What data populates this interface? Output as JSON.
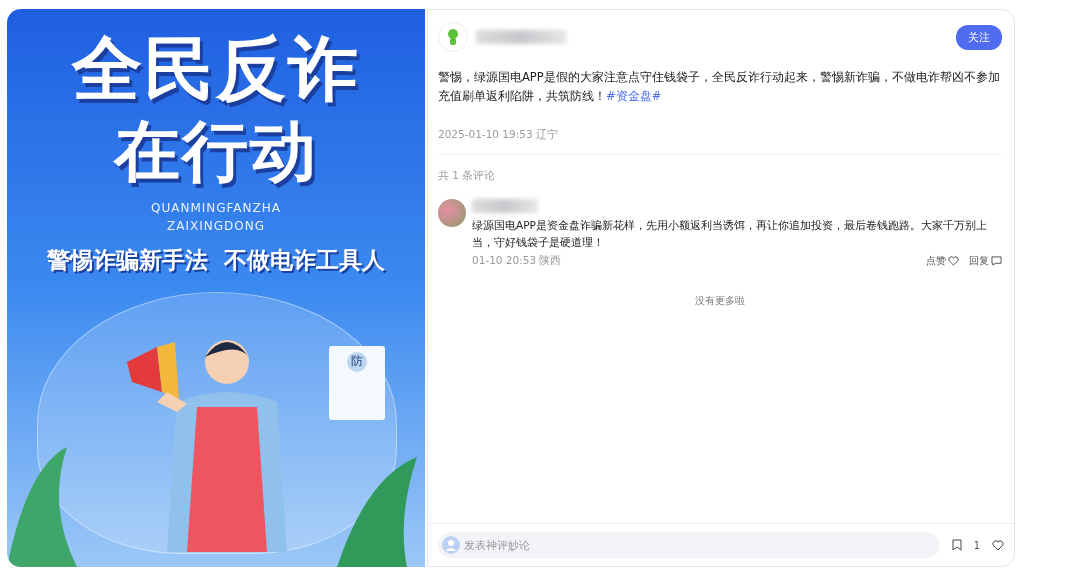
{
  "poster": {
    "title_lines": [
      "全民反诈",
      "在行动"
    ],
    "pinyin_lines": [
      "QUANMINGFANZHA",
      "ZAIXINGDONG"
    ],
    "slogan": "警惕诈骗新手法  不做电诈工具人",
    "document_label": "防"
  },
  "post": {
    "follow_button": "关注",
    "text": "警惕，绿源国电APP是假的大家注意点守住钱袋子，全民反诈行动起来，警惕新诈骗，不做电诈帮凶不参加充值刷单返利陷阱，共筑防线！",
    "hashtag": "#资金盘#",
    "meta": "2025-01-10 19:53 辽宁"
  },
  "comments_header": "共 1 条评论",
  "comments": [
    {
      "text": "绿源国电APP是资金盘诈骗新花样，先用小额返利当诱饵，再让你追加投资，最后卷钱跑路。大家千万别上当，守好钱袋子是硬道理！",
      "meta": "01-10 20:53 陕西",
      "like_label": "点赞",
      "reply_label": "回复"
    }
  ],
  "end_note": "没有更多啦",
  "composer": {
    "placeholder": "发表神评妙论",
    "count": "1"
  }
}
